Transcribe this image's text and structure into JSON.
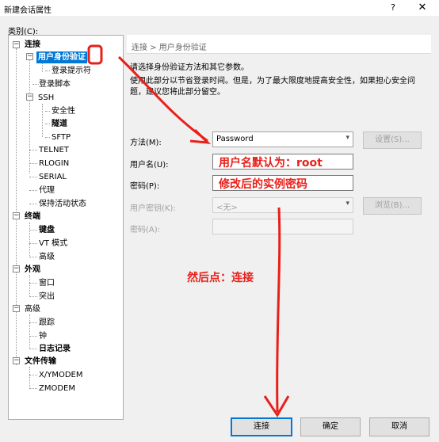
{
  "window": {
    "title": "新建会话属性",
    "help": "?",
    "close": "✕"
  },
  "category_label": "类别(C):",
  "tree": {
    "connection": "连接",
    "user_auth": "用户身份验证",
    "login_prompt": "登录提示符",
    "login_script": "登录脚本",
    "ssh": "SSH",
    "security": "安全性",
    "tunnel": "隧道",
    "sftp": "SFTP",
    "telnet": "TELNET",
    "rlogin": "RLOGIN",
    "serial": "SERIAL",
    "proxy": "代理",
    "keepalive": "保持活动状态",
    "terminal": "终端",
    "keyboard": "键盘",
    "vt_mode": "VT 模式",
    "advanced1": "高级",
    "appearance": "外观",
    "window": "窗口",
    "highlight": "突出",
    "advanced2": "高级",
    "trace": "跟踪",
    "bell": "钟",
    "logging": "日志记录",
    "file_transfer": "文件传输",
    "xymodem": "X/YMODEM",
    "zmodem": "ZMODEM"
  },
  "content": {
    "breadcrumb": "连接 > 用户身份验证",
    "desc1": "请选择身份验证方法和其它参数。",
    "desc2": "使用此部分以节省登录时间。但是，为了最大限度地提高安全性，如果担心安全问题，建议您将此部分留空。",
    "method_label": "方法(M):",
    "method_value": "Password",
    "settings_button": "设置(S)...",
    "username_label": "用户名(U):",
    "password_label": "密码(P):",
    "userkey_label": "用户密钥(K):",
    "userkey_value": "<无>",
    "browse_button": "浏览(B)...",
    "passphrase_label": "密码(A):"
  },
  "annotations": {
    "username_note": "用户名默认为：root",
    "password_note": "修改后的实例密码",
    "then_click": "然后点：连接",
    "marker_color": "#e8201a"
  },
  "buttons": {
    "connect": "连接",
    "ok": "确定",
    "cancel": "取消"
  }
}
